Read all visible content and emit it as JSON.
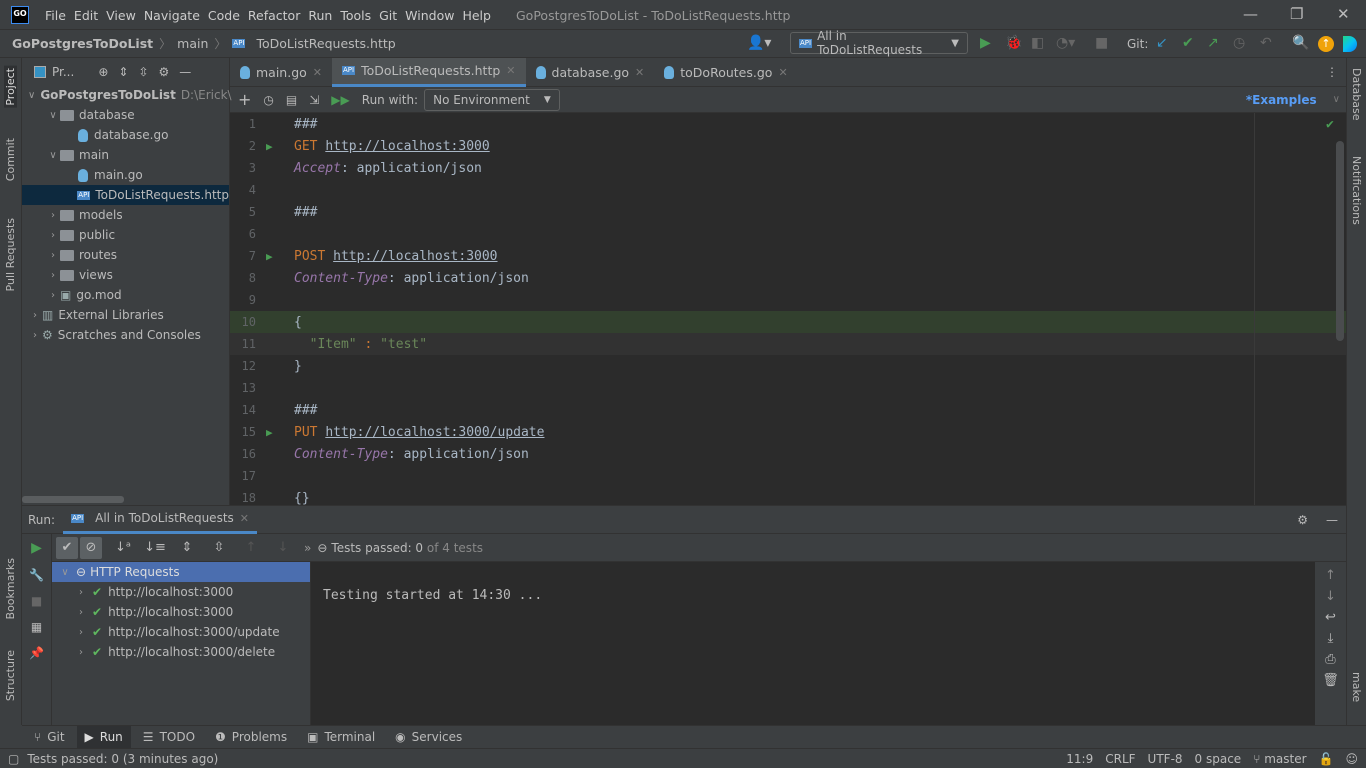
{
  "app": {
    "logo": "GO",
    "menu": [
      "File",
      "Edit",
      "View",
      "Navigate",
      "Code",
      "Refactor",
      "Run",
      "Tools",
      "Git",
      "Window",
      "Help"
    ],
    "title": "GoPostgresToDoList - ToDoListRequests.http"
  },
  "nav": {
    "crumbs": [
      "GoPostgresToDoList",
      "main",
      "ToDoListRequests.http"
    ],
    "run_config": "All in ToDoListRequests",
    "git_label": "Git:"
  },
  "stripe_left": [
    "Project",
    "Commit",
    "Pull Requests",
    "Bookmarks",
    "Structure"
  ],
  "stripe_right": [
    "Database",
    "Notifications",
    "make"
  ],
  "project": {
    "title": "Pr...",
    "tree": [
      {
        "label": "GoPostgresToDoList",
        "extra": "D:\\Erick\\",
        "depth": 0,
        "type": "folder",
        "open": true,
        "bold": true
      },
      {
        "label": "database",
        "depth": 1,
        "type": "folder",
        "open": true
      },
      {
        "label": "database.go",
        "depth": 2,
        "type": "go"
      },
      {
        "label": "main",
        "depth": 1,
        "type": "folder",
        "open": true
      },
      {
        "label": "main.go",
        "depth": 2,
        "type": "go"
      },
      {
        "label": "ToDoListRequests.http",
        "depth": 2,
        "type": "api",
        "selected": true
      },
      {
        "label": "models",
        "depth": 1,
        "type": "folder",
        "open": false
      },
      {
        "label": "public",
        "depth": 1,
        "type": "folder",
        "open": false
      },
      {
        "label": "routes",
        "depth": 1,
        "type": "folder",
        "open": false
      },
      {
        "label": "views",
        "depth": 1,
        "type": "folder",
        "open": false
      },
      {
        "label": "go.mod",
        "depth": 1,
        "type": "mod",
        "open": false
      },
      {
        "label": "External Libraries",
        "depth": 0,
        "type": "lib",
        "open": false
      },
      {
        "label": "Scratches and Consoles",
        "depth": 0,
        "type": "scratch",
        "open": false
      }
    ]
  },
  "tabs": [
    {
      "label": "main.go",
      "type": "go"
    },
    {
      "label": "ToDoListRequests.http",
      "type": "api",
      "active": true
    },
    {
      "label": "database.go",
      "type": "go"
    },
    {
      "label": "toDoRoutes.go",
      "type": "go"
    }
  ],
  "editor_toolbar": {
    "run_with": "Run with:",
    "environment": "No Environment",
    "examples": "*Examples"
  },
  "code": [
    {
      "n": "1",
      "t": [
        [
          "c",
          "###"
        ]
      ]
    },
    {
      "n": "2",
      "run": true,
      "t": [
        [
          "kw",
          "GET "
        ],
        [
          "url",
          "http://localhost:3000"
        ]
      ]
    },
    {
      "n": "3",
      "t": [
        [
          "hd",
          "Accept"
        ],
        [
          "c",
          ": application/json"
        ]
      ]
    },
    {
      "n": "4",
      "t": []
    },
    {
      "n": "5",
      "t": [
        [
          "c",
          "###"
        ]
      ]
    },
    {
      "n": "6",
      "t": []
    },
    {
      "n": "7",
      "run": true,
      "t": [
        [
          "kw",
          "POST "
        ],
        [
          "url",
          "http://localhost:3000"
        ]
      ]
    },
    {
      "n": "8",
      "t": [
        [
          "hd",
          "Content-Type"
        ],
        [
          "c",
          ": application/json"
        ]
      ]
    },
    {
      "n": "9",
      "t": []
    },
    {
      "n": "10",
      "hl2": true,
      "t": [
        [
          "c",
          "{"
        ]
      ]
    },
    {
      "n": "11",
      "hl": true,
      "t": [
        [
          "c",
          "  "
        ],
        [
          "str",
          "\"Item\""
        ],
        [
          "kw",
          " : "
        ],
        [
          "str",
          "\"test\""
        ]
      ]
    },
    {
      "n": "12",
      "t": [
        [
          "c",
          "}"
        ]
      ]
    },
    {
      "n": "13",
      "t": []
    },
    {
      "n": "14",
      "t": [
        [
          "c",
          "###"
        ]
      ]
    },
    {
      "n": "15",
      "run": true,
      "t": [
        [
          "kw",
          "PUT "
        ],
        [
          "url",
          "http://localhost:3000/update"
        ]
      ]
    },
    {
      "n": "16",
      "t": [
        [
          "hd",
          "Content-Type"
        ],
        [
          "c",
          ": application/json"
        ]
      ]
    },
    {
      "n": "17",
      "t": []
    },
    {
      "n": "18",
      "t": [
        [
          "c",
          "{}"
        ]
      ]
    }
  ],
  "run": {
    "label": "Run:",
    "tab": "All in ToDoListRequests",
    "tests_passed_label": "Tests passed: 0",
    "tests_of": " of 4 tests",
    "root": "HTTP Requests",
    "items": [
      "http://localhost:3000",
      "http://localhost:3000",
      "http://localhost:3000/update",
      "http://localhost:3000/delete"
    ],
    "output": "Testing started at 14:30 ..."
  },
  "bottom_tabs": [
    {
      "label": "Git",
      "icon": "git-icon"
    },
    {
      "label": "Run",
      "icon": "run-icon",
      "active": true
    },
    {
      "label": "TODO",
      "icon": "list-icon"
    },
    {
      "label": "Problems",
      "icon": "warning-icon"
    },
    {
      "label": "Terminal",
      "icon": "terminal-icon"
    },
    {
      "label": "Services",
      "icon": "services-icon"
    }
  ],
  "status": {
    "message": "Tests passed: 0 (3 minutes ago)",
    "position": "11:9",
    "line_sep": "CRLF",
    "encoding": "UTF-8",
    "indent": "0 space",
    "branch": "master"
  }
}
